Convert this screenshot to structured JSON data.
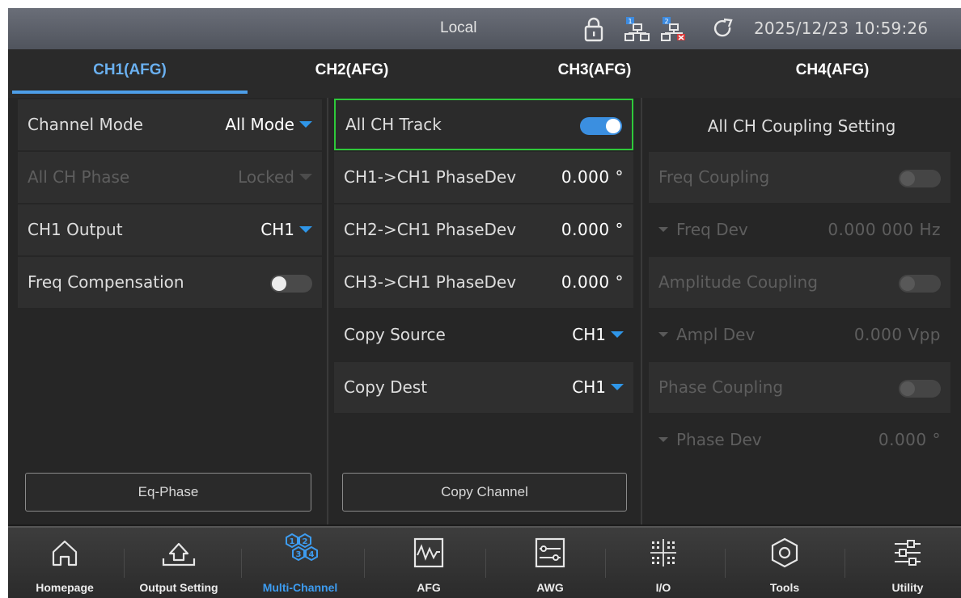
{
  "status": {
    "mode": "Local",
    "datetime": "2025/12/23 10:59:26",
    "icons": [
      "lock-icon",
      "network-1-icon",
      "network-2-disconnected-icon",
      "refresh-icon"
    ]
  },
  "tabs": [
    {
      "label": "CH1(AFG)",
      "active": true
    },
    {
      "label": "CH2(AFG)",
      "active": false
    },
    {
      "label": "CH3(AFG)",
      "active": false
    },
    {
      "label": "CH4(AFG)",
      "active": false
    }
  ],
  "left": {
    "channel_mode": {
      "label": "Channel Mode",
      "value": "All Mode"
    },
    "all_ch_phase": {
      "label": "All CH Phase",
      "value": "Locked"
    },
    "ch1_output": {
      "label": "CH1 Output",
      "value": "CH1"
    },
    "freq_compensation": {
      "label": "Freq Compensation",
      "on": false
    },
    "eq_phase_button": "Eq-Phase"
  },
  "middle": {
    "all_ch_track": {
      "label": "All CH Track",
      "on": true
    },
    "ch1_phasedev": {
      "label": "CH1->CH1 PhaseDev",
      "value": "0.000 °"
    },
    "ch2_phasedev": {
      "label": "CH2->CH1 PhaseDev",
      "value": "0.000 °"
    },
    "ch3_phasedev": {
      "label": "CH3->CH1 PhaseDev",
      "value": "0.000 °"
    },
    "copy_source": {
      "label": "Copy Source",
      "value": "CH1"
    },
    "copy_dest": {
      "label": "Copy Dest",
      "value": "CH1"
    },
    "copy_channel_button": "Copy Channel"
  },
  "right": {
    "title": "All CH Coupling Setting",
    "freq_coupling": {
      "label": "Freq Coupling",
      "on": false
    },
    "freq_dev": {
      "label": "Freq Dev",
      "value": "0.000 000 Hz"
    },
    "amplitude_coupling": {
      "label": "Amplitude Coupling",
      "on": false
    },
    "ampl_dev": {
      "label": "Ampl Dev",
      "value": "0.000 Vpp"
    },
    "phase_coupling": {
      "label": "Phase Coupling",
      "on": false
    },
    "phase_dev": {
      "label": "Phase Dev",
      "value": "0.000 °"
    }
  },
  "nav": [
    {
      "label": "Homepage",
      "icon": "home-icon",
      "active": false
    },
    {
      "label": "Output Setting",
      "icon": "output-setting-icon",
      "active": false
    },
    {
      "label": "Multi-Channel",
      "icon": "multi-channel-icon",
      "active": true
    },
    {
      "label": "AFG",
      "icon": "afg-waveform-icon",
      "active": false
    },
    {
      "label": "AWG",
      "icon": "awg-icon",
      "active": false
    },
    {
      "label": "I/O",
      "icon": "io-grid-icon",
      "active": false
    },
    {
      "label": "Tools",
      "icon": "tools-hexagon-icon",
      "active": false
    },
    {
      "label": "Utility",
      "icon": "utility-sliders-icon",
      "active": false
    }
  ],
  "colors": {
    "accent": "#3d9cf0",
    "highlight": "#2ec93a",
    "background": "#1b1b1b"
  }
}
